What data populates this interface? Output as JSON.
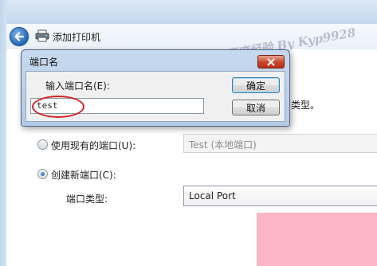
{
  "wizard": {
    "title": "添加打印机",
    "watermark": "百度经验 By Kyp9928",
    "port_type_trailing": "类型。",
    "options": {
      "use_existing": {
        "label": "使用现有的端口(U):",
        "value": "Test (本地端口)",
        "selected": false
      },
      "create_new": {
        "label": "创建新端口(C):",
        "selected": true
      },
      "port_type": {
        "label": "端口类型:",
        "value": "Local Port"
      }
    }
  },
  "dialog": {
    "title": "端口名",
    "prompt": "输入端口名(E):",
    "input_value": "test",
    "ok_label": "确定",
    "cancel_label": "取消"
  },
  "colors": {
    "annotation": "#d42424",
    "pink_overlay": "#fbb5c7"
  }
}
